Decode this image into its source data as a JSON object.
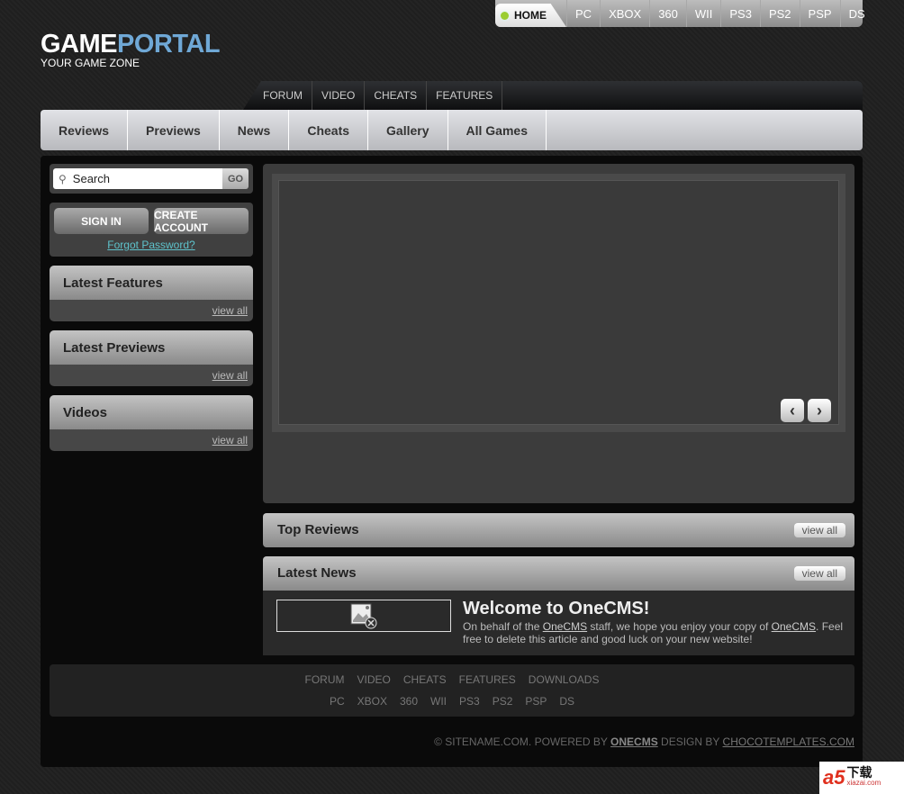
{
  "topnav": {
    "home": "HOME",
    "items": [
      "PC",
      "XBOX",
      "360",
      "WII",
      "PS3",
      "PS2",
      "PSP",
      "DS"
    ]
  },
  "logo": {
    "part1": "GAME",
    "part2": "PORTAL",
    "tagline": "YOUR GAME ZONE"
  },
  "subnav": [
    "FORUM",
    "VIDEO",
    "CHEATS",
    "FEATURES"
  ],
  "mainnav": [
    "Reviews",
    "Previews",
    "News",
    "Cheats",
    "Gallery",
    "All Games"
  ],
  "search": {
    "placeholder": "Search",
    "go": "GO"
  },
  "login": {
    "sign_in": "SIGN IN",
    "create": "CREATE ACCOUNT",
    "forgot": "Forgot Password?"
  },
  "panels": [
    {
      "title": "Latest Features",
      "link": "view all"
    },
    {
      "title": "Latest Previews",
      "link": "view all"
    },
    {
      "title": "Videos",
      "link": "view all"
    }
  ],
  "slider": {
    "prev": "‹",
    "next": "›"
  },
  "top_reviews": {
    "title": "Top Reviews",
    "link": "view all"
  },
  "latest_news": {
    "title": "Latest News",
    "link": "view all",
    "article": {
      "title": "Welcome to OneCMS!",
      "text1": "On behalf of the ",
      "link1": "OneCMS",
      "text2": " staff, we hope you enjoy your copy of ",
      "link2": "OneCMS",
      "text3": ". Feel free to delete this article and good luck on your new website!"
    }
  },
  "footer": {
    "row1": [
      "FORUM",
      "VIDEO",
      "CHEATS",
      "FEATURES",
      "DOWNLOADS"
    ],
    "row2": [
      "PC",
      "XBOX",
      "360",
      "WII",
      "PS3",
      "PS2",
      "PSP",
      "DS"
    ],
    "copy1": "© SITENAME.COM. POWERED BY ",
    "powered": "ONECMS",
    "copy2": " DESIGN BY ",
    "designer": "CHOCOTEMPLATES.COM"
  },
  "watermark": {
    "logo": "a5",
    "text": "下载",
    "sub": "xiazai.com"
  }
}
